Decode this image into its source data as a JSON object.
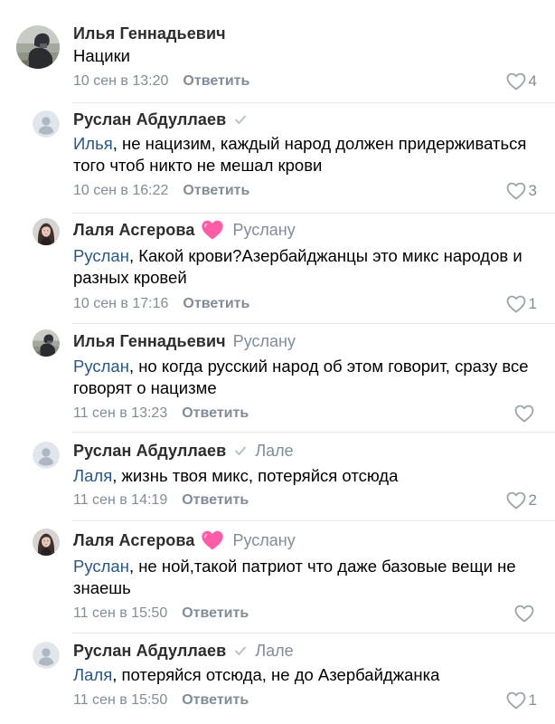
{
  "reply_label": "Ответить",
  "icons": {
    "like": "heart-outline-icon",
    "verified": "checkmark-icon",
    "badge": "pink-heart-icon"
  },
  "colors": {
    "mention": "#2a5885",
    "secondary": "#818c99",
    "badge": "#ff5ca8"
  },
  "comments": [
    {
      "author": "Илья Геннадьевич",
      "reply_to": "",
      "mention": "",
      "text": "Нацики",
      "date": "10 сен в 13:20",
      "likes": "4"
    },
    {
      "author": "Руслан Абдуллаев",
      "reply_to": "",
      "mention": "Илья",
      "text": ", не нацизим, каждый народ должен придерживаться того чтоб никто не мешал крови",
      "date": "10 сен в 16:22",
      "likes": "3"
    },
    {
      "author": "Лаля Асгерова",
      "reply_to": "Руслану",
      "mention": "Руслан",
      "text": ", Какой крови?Азербайджанцы это микс народов и разных кровей",
      "date": "10 сен в 17:16",
      "likes": "1"
    },
    {
      "author": "Илья Геннадьевич",
      "reply_to": "Руслану",
      "mention": "Руслан",
      "text": ", но когда русский народ об этом говорит, сразу все говорят о нацизме",
      "date": "11 сен в 13:23",
      "likes": ""
    },
    {
      "author": "Руслан Абдуллаев",
      "reply_to": "Лале",
      "mention": "Лаля",
      "text": ", жизнь твоя микс, потеряйся отсюда",
      "date": "11 сен в 14:19",
      "likes": "2"
    },
    {
      "author": "Лаля Асгерова",
      "reply_to": "Руслану",
      "mention": "Руслан",
      "text": ", не ной,такой патриот что даже базовые вещи не знаешь",
      "date": "11 сен в 15:50",
      "likes": ""
    },
    {
      "author": "Руслан Абдуллаев",
      "reply_to": "Лале",
      "mention": "Лаля",
      "text": ", потеряйся отсюда, не до Азербайджанка",
      "date": "11 сен в 15:50",
      "likes": "1"
    }
  ]
}
